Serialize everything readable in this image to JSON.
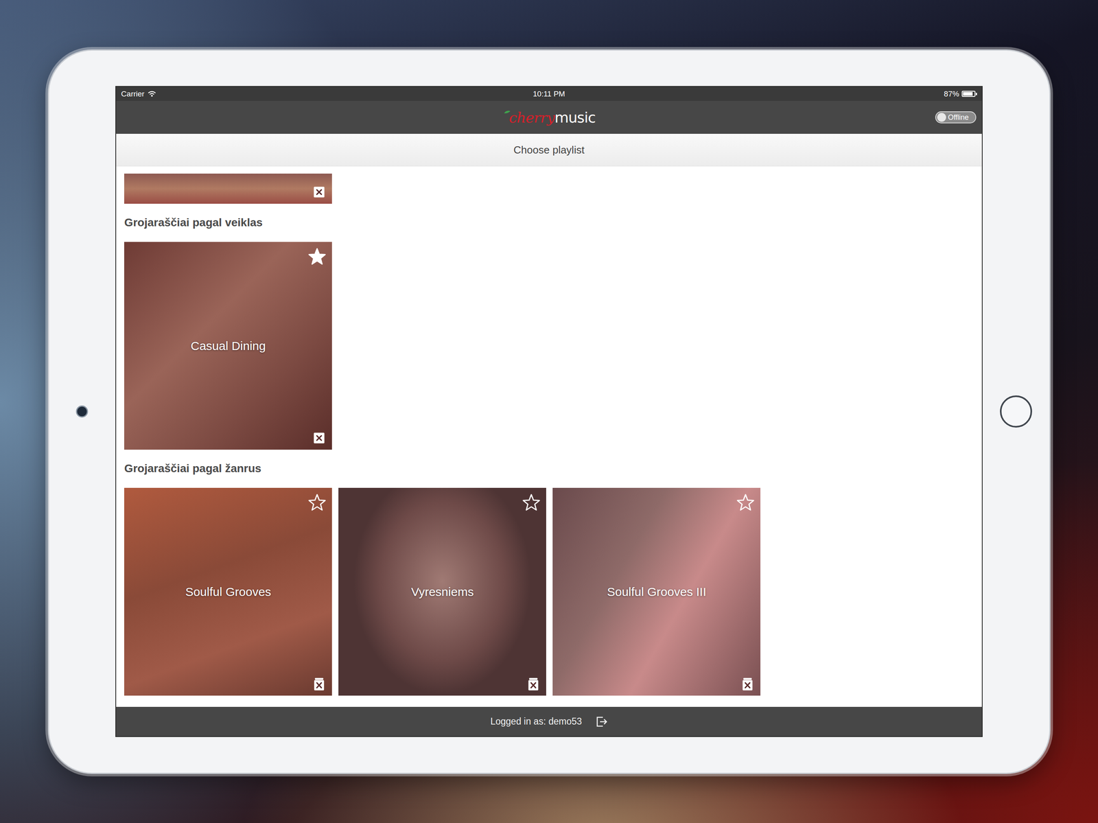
{
  "status_bar": {
    "carrier": "Carrier",
    "time": "10:11 PM",
    "battery": "87%",
    "battery_level": 0.87
  },
  "nav": {
    "logo": {
      "cherry": "cherry",
      "music": "music"
    },
    "offline": {
      "label": "Offline",
      "on": false
    }
  },
  "header": {
    "title": "Choose playlist"
  },
  "clipped_card": {
    "kind": "removable"
  },
  "sections": [
    {
      "title": "Grojaraščiai pagal veiklas",
      "playlists": [
        {
          "name": "Casual Dining",
          "favorite": true,
          "kind": "removable"
        }
      ]
    },
    {
      "title": "Grojaraščiai pagal žanrus",
      "playlists": [
        {
          "name": "Soulful Grooves",
          "favorite": false,
          "kind": "deletable"
        },
        {
          "name": "Vyresniems",
          "favorite": false,
          "kind": "deletable"
        },
        {
          "name": "Soulful Grooves III",
          "favorite": false,
          "kind": "deletable"
        }
      ]
    }
  ],
  "footer": {
    "label": "Logged in as: demo53"
  }
}
